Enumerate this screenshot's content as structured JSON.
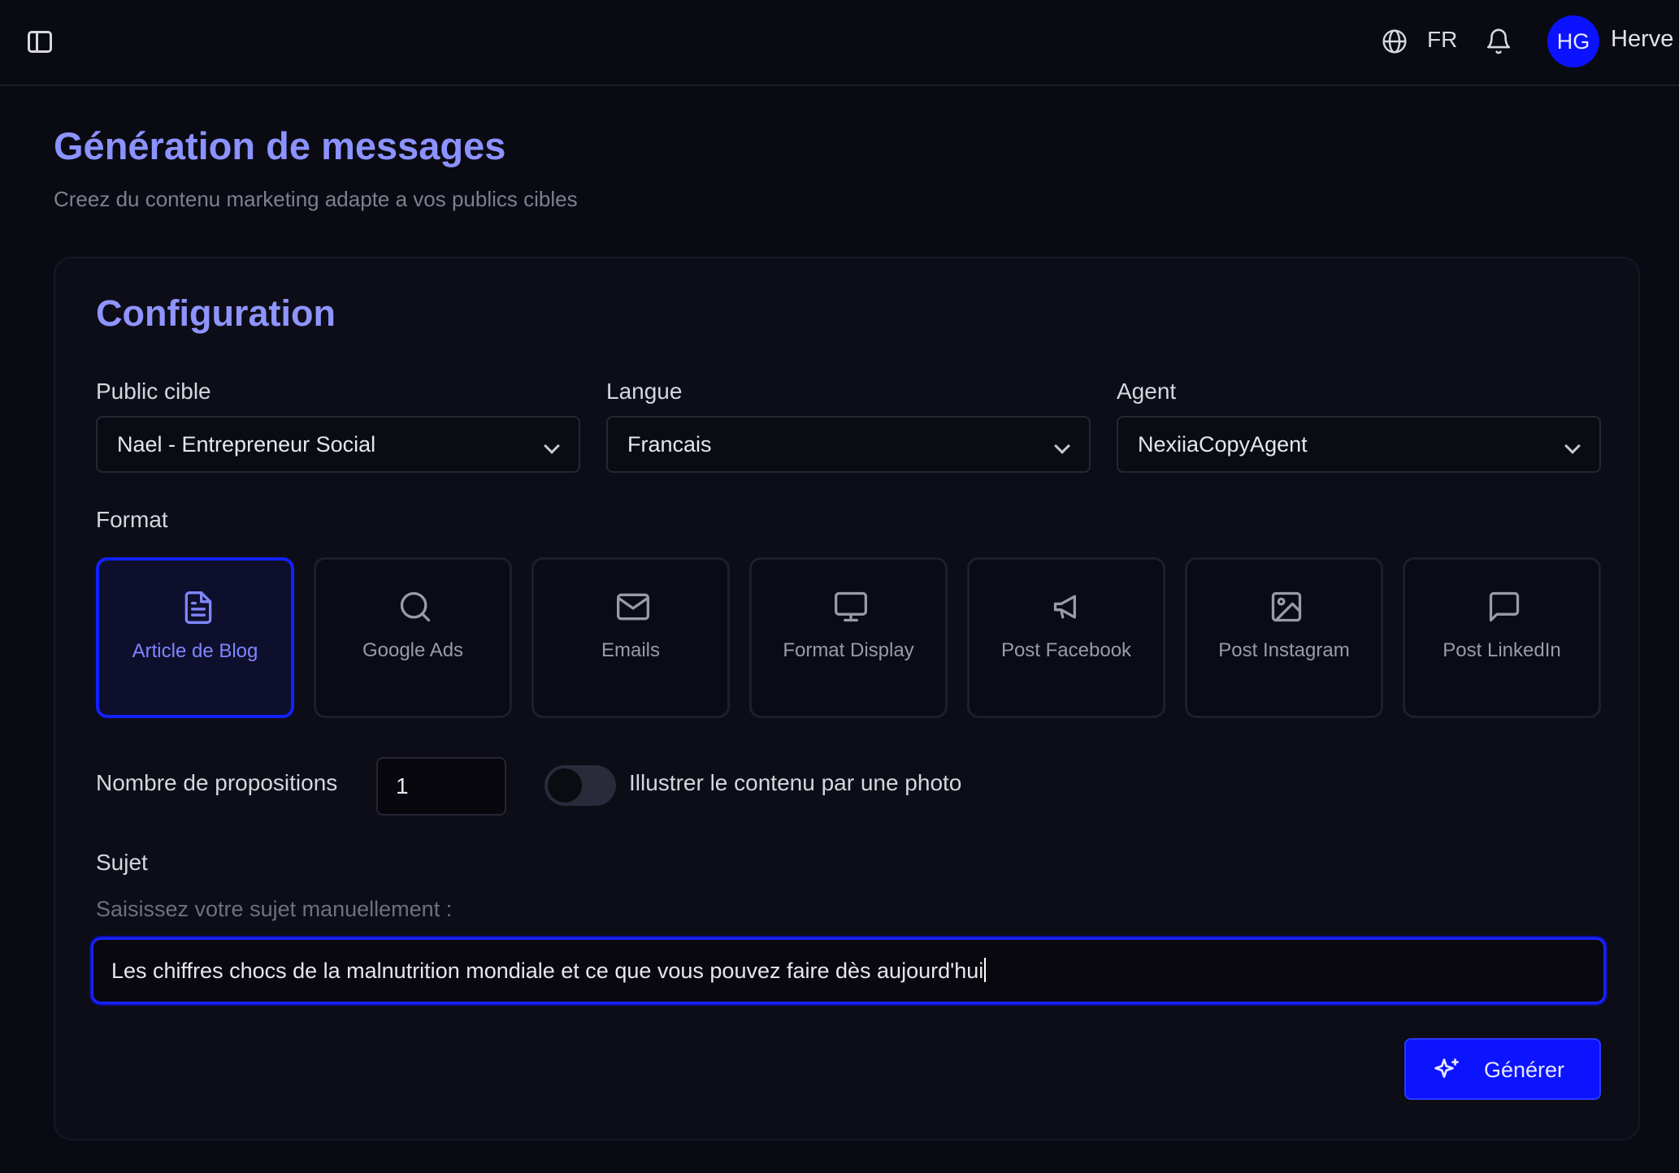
{
  "topbar": {
    "sidebar_toggle_icon": "sidebar-panel-icon",
    "language_icon": "globe-icon",
    "language_code": "FR",
    "notifications_icon": "bell-icon",
    "user_initials": "HG",
    "user_name": "Herve",
    "avatar_color": "#0a12ff"
  },
  "header": {
    "title": "Génération de messages",
    "subtitle": "Creez du contenu marketing adapte a vos publics cibles"
  },
  "config": {
    "title": "Configuration",
    "public_cible": {
      "label": "Public cible",
      "value": "Nael - Entrepreneur Social"
    },
    "langue": {
      "label": "Langue",
      "value": "Francais"
    },
    "agent": {
      "label": "Agent",
      "value": "NexiiaCopyAgent"
    },
    "format": {
      "label": "Format",
      "selected": "Article de Blog",
      "options": [
        {
          "label": "Article de Blog",
          "icon": "document-icon",
          "active": true
        },
        {
          "label": "Google Ads",
          "icon": "search-icon",
          "active": false
        },
        {
          "label": "Emails",
          "icon": "mail-icon",
          "active": false
        },
        {
          "label": "Format Display",
          "icon": "monitor-icon",
          "active": false
        },
        {
          "label": "Post Facebook",
          "icon": "megaphone-icon",
          "active": false
        },
        {
          "label": "Post Instagram",
          "icon": "image-icon",
          "active": false
        },
        {
          "label": "Post LinkedIn",
          "icon": "message-square-icon",
          "active": false
        }
      ]
    },
    "propositions": {
      "label": "Nombre de propositions",
      "value": "1"
    },
    "photo_toggle": {
      "label": "Illustrer le contenu par une photo",
      "enabled": false
    },
    "sujet": {
      "label": "Sujet",
      "hint": "Saisissez votre sujet manuellement :",
      "value": "Les chiffres chocs de la malnutrition mondiale et ce que vous pouvez faire dès aujourd'hui"
    },
    "generate_label": "Générer",
    "accent_color": "#0b13ff",
    "title_color": "#8c92ff"
  }
}
